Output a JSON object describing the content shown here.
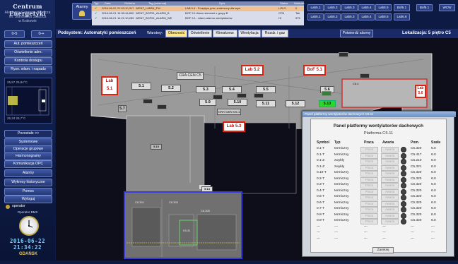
{
  "app": {
    "logo_title": "Centrum Energetyki",
    "logo_subtitle": [
      "Akademia Górniczo-Hutnicza",
      "im. Stanisława Staszica",
      "w Krakowie"
    ]
  },
  "alarm_button": "Alarmy",
  "alarm_table": {
    "columns": [
      "Typ",
      "Data",
      "Godzina",
      "Tag (zmienna)",
      "Opis",
      "Status",
      "Wartość"
    ],
    "rows": [
      {
        "date": "2016-06-22",
        "time": "21:03:10,317",
        "tag": "WENT_LABS4_FW",
        "desc": "LAB 5.4 - Przepływ pow. zmierzony dla wyw",
        "status": "LOLO",
        "value": "0"
      },
      {
        "date": "2016-06-21",
        "time": "14:30:44,800",
        "tag": "WENT_BOF51_ALARM_B",
        "desc": "BOF 5.1 Alarm sterowni z grupy B",
        "status": "CFN",
        "value": "Tak"
      },
      {
        "date": "2016-06-21",
        "time": "14:21:10,289",
        "tag": "WENT_BOF51_ALARM_WE",
        "desc": "BOF 5.1 - Alarm alarmu wentylatorów",
        "status": "HI",
        "value": "975"
      }
    ]
  },
  "view_buttons_top": [
    "Lab5.1",
    "Lab5.2",
    "Lab5.3",
    "Lab5.4",
    "Lab5.5",
    "Bof5.1",
    "Bof5.1",
    "WCW"
  ],
  "view_buttons_bottom": [
    "Lab5.1",
    "Lab5.2",
    "Lab5.3",
    "Lab5.4",
    "Lab5.5",
    "Lab5.6"
  ],
  "left_nav": {
    "small_buttons": [
      "0-5",
      "0-+"
    ],
    "buttons_top": [
      "Aut. pomieszczeń",
      "Oświetlenie adm.",
      "Kontrola dostępu",
      "Rysn. wlam. i napadu"
    ],
    "minimap_labels": [
      "25,57  25,94°C",
      "26,34  26,7°C"
    ],
    "pozostale": "Pozostałe  >>",
    "buttons_bottom": [
      "Systemowe",
      "Operacje grupowe",
      "Harmonogramy",
      "Komunikacja OPC",
      "Alarmy",
      "Wykresy historyczne",
      "Pomoc",
      "Wyloguj"
    ],
    "user_role": "operator",
    "user_name": "Operator BMS",
    "date": "2016-06-22",
    "time": "21:34:22",
    "footer": "GDAŃSK"
  },
  "header": {
    "subsystem": "Podsystem: Automatyki pomieszczeń",
    "layers_label": "Warstwy:",
    "tabs": [
      "Obecność",
      "Oświetlenie",
      "Klimakonw.",
      "Wentylacja",
      "Rozdz. i gaz"
    ],
    "confirm_button": "Potwierdź alarmy",
    "location": "Lokalizacja: 5 piętro C5"
  },
  "plan": {
    "room_labels": [
      "Lab 5.1",
      "Lab 5.2",
      "BoF 5.1",
      "Lab 5.3",
      "Lab 5.6"
    ],
    "area_labels": [
      "CRA CEN C5",
      "CRA CEN C5.1"
    ],
    "units": [
      "5.1",
      "5.2",
      "5.3",
      "5.4",
      "5.5",
      "5.6",
      "5.7",
      "5.9",
      "5.10",
      "5.11",
      "5.12",
      "5.13",
      "5.14",
      "5.15"
    ],
    "room_codes": [
      "C6.301",
      "C6.303",
      "C6.305",
      "K5.31",
      "C6.4"
    ]
  },
  "dialog": {
    "window_title": "Panel platformy wentylatorów dachowych C5.11",
    "title": "Panel platformy wentylatorów dachowych",
    "subtitle": "Platforma C5.11",
    "columns": [
      "Symbol",
      "Typ",
      "Praca",
      "Awaria",
      "Pom.",
      "Szafa"
    ],
    "status_work": "Praca",
    "status_fault": "Awaria",
    "rows": [
      {
        "symbol": "0.1-T",
        "type": "termiczny",
        "room": "C5.320",
        "cab": "6.0"
      },
      {
        "symbol": "0.1-T",
        "type": "termiczny",
        "room": "C5.417",
        "cab": "6.0"
      },
      {
        "symbol": "0.1-Z",
        "type": "zwykły",
        "room": "C5.210",
        "cab": "6.0"
      },
      {
        "symbol": "0.1-Z",
        "type": "zwykły",
        "room": "C5.321",
        "cab": "6.0"
      },
      {
        "symbol": "0.10-T",
        "type": "termiczny",
        "room": "C5.320",
        "cab": "6.0"
      },
      {
        "symbol": "0.2-T",
        "type": "termiczny",
        "room": "C5.320",
        "cab": "6.0"
      },
      {
        "symbol": "0.3-T",
        "type": "termiczny",
        "room": "C5.320",
        "cab": "6.0"
      },
      {
        "symbol": "0.4-T",
        "type": "termiczny",
        "room": "C5.320",
        "cab": "6.0"
      },
      {
        "symbol": "0.5-T",
        "type": "termiczny",
        "room": "C5.320",
        "cab": "6.0"
      },
      {
        "symbol": "0.6-T",
        "type": "termiczny",
        "room": "C5.320",
        "cab": "6.0"
      },
      {
        "symbol": "0.7-T",
        "type": "termiczny",
        "room": "C5.320",
        "cab": "6.0"
      },
      {
        "symbol": "0.8-T",
        "type": "termiczny",
        "room": "C5.320",
        "cab": "6.0"
      },
      {
        "symbol": "0.9-T",
        "type": "termiczny",
        "room": "C5.320",
        "cab": "6.0"
      },
      {
        "symbol": "---",
        "type": "---",
        "room": "---",
        "cab": "---"
      },
      {
        "symbol": "---",
        "type": "---",
        "room": "---",
        "cab": "---"
      },
      {
        "symbol": "---",
        "type": "---",
        "room": "---",
        "cab": "---"
      }
    ],
    "close_button": "Zamknij"
  },
  "colors": {
    "accent": "#e4c85a",
    "alarm_red": "#d21111",
    "active_green": "#2fd42f"
  }
}
